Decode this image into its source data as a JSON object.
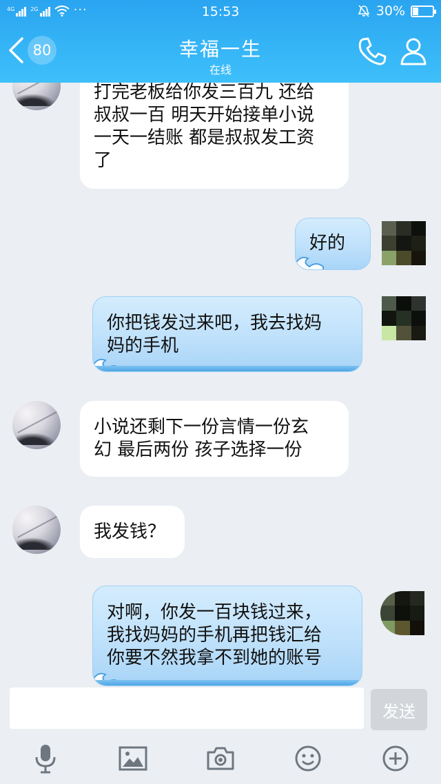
{
  "status_bar": {
    "network1": "4G",
    "network2": "2G",
    "dots": "···",
    "time": "15:53",
    "battery_percent": "30%",
    "battery_level": 0.3
  },
  "title_bar": {
    "unread_count": "80",
    "contact_name": "幸福一生",
    "contact_status": "在线"
  },
  "messages": [
    {
      "side": "in",
      "text": "打完老板给你发三百九 还给\n叔叔一百 明天开始接单小说\n一天一结账 都是叔叔发工资\n了"
    },
    {
      "side": "out",
      "text": "好的"
    },
    {
      "side": "out",
      "text": "你把钱发过来吧，我去找妈\n妈的手机"
    },
    {
      "side": "in",
      "text": "小说还剩下一份言情一份玄\n幻 最后两份 孩子选择一份"
    },
    {
      "side": "in",
      "text": "我发钱？"
    },
    {
      "side": "out",
      "text": "对啊，你发一百块钱过来，\n我找妈妈的手机再把钱汇给\n你要不然我拿不到她的账号"
    }
  ],
  "input": {
    "value": "",
    "send_label": "发送"
  },
  "toolbar": {
    "icons": [
      "microphone-icon",
      "image-icon",
      "camera-icon",
      "emoji-icon",
      "plus-icon"
    ]
  },
  "colors": {
    "header": "#35b4f6",
    "background": "#ebeef3",
    "outgoing_bubble": "#bfe1fb",
    "incoming_bubble": "#ffffff"
  }
}
